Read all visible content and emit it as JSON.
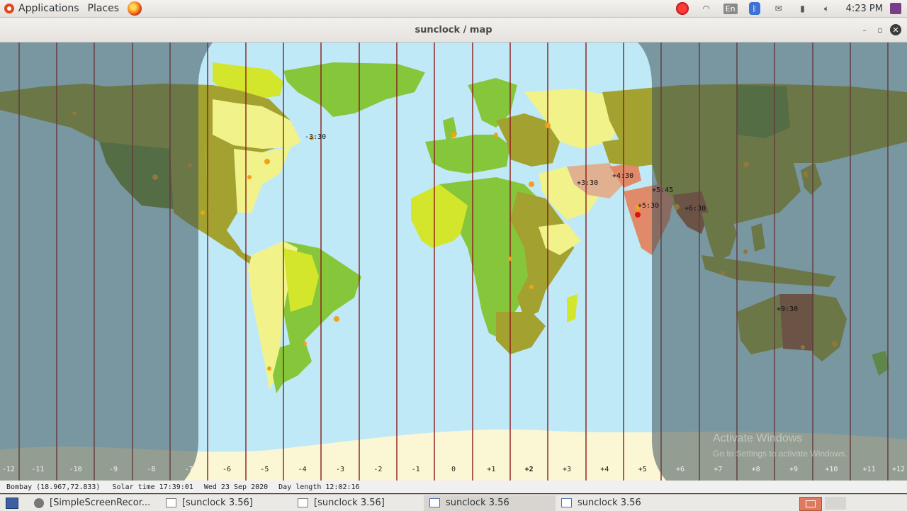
{
  "top_panel": {
    "applications_label": "Applications",
    "places_label": "Places",
    "keyboard_layout": "En",
    "clock": "4:23 PM"
  },
  "window": {
    "title": "sunclock / map"
  },
  "map": {
    "timezone_labels": [
      "-12",
      "-11",
      "-10",
      "-9",
      "-8",
      "-7",
      "-6",
      "-5",
      "-4",
      "-3",
      "-2",
      "-1",
      "0",
      "+1",
      "+2",
      "+3",
      "+4",
      "+5",
      "+6",
      "+7",
      "+8",
      "+9",
      "+10",
      "+11",
      "+12"
    ],
    "offset_labels": [
      "-3:30",
      "+3:30",
      "+4:30",
      "+5:45",
      "+5:30",
      "+6:30",
      "+9:30"
    ],
    "watermark_title": "Activate Windows",
    "watermark_subtitle": "Go to Settings to activate Windows.",
    "colors": {
      "ocean": "#bfe9f7",
      "night_shade": "#5d6f74",
      "zone_line": "#8b1a1a",
      "land_green": "#86c63a",
      "land_olive": "#a3a231",
      "land_yellow": "#f1f38a",
      "land_lime": "#d4e62c",
      "land_dark": "#6f8c2a",
      "land_salmon": "#e08a6a",
      "ice": "#fbf7d4"
    }
  },
  "status_bar": {
    "location": "Bombay (18.967,72.833)",
    "solar_time": "Solar time 17:39:01",
    "date": "Wed 23 Sep 2020",
    "day_length": "Day length 12:02:16"
  },
  "taskbar": {
    "tasks": [
      {
        "label": "[SimpleScreenRecor...",
        "icon": "screen-recorder-icon"
      },
      {
        "label": "[sunclock 3.56]",
        "icon": "window-icon"
      },
      {
        "label": "[sunclock 3.56]",
        "icon": "window-icon"
      },
      {
        "label": "sunclock 3.56",
        "icon": "window-icon"
      },
      {
        "label": "sunclock 3.56",
        "icon": "window-icon"
      }
    ]
  }
}
